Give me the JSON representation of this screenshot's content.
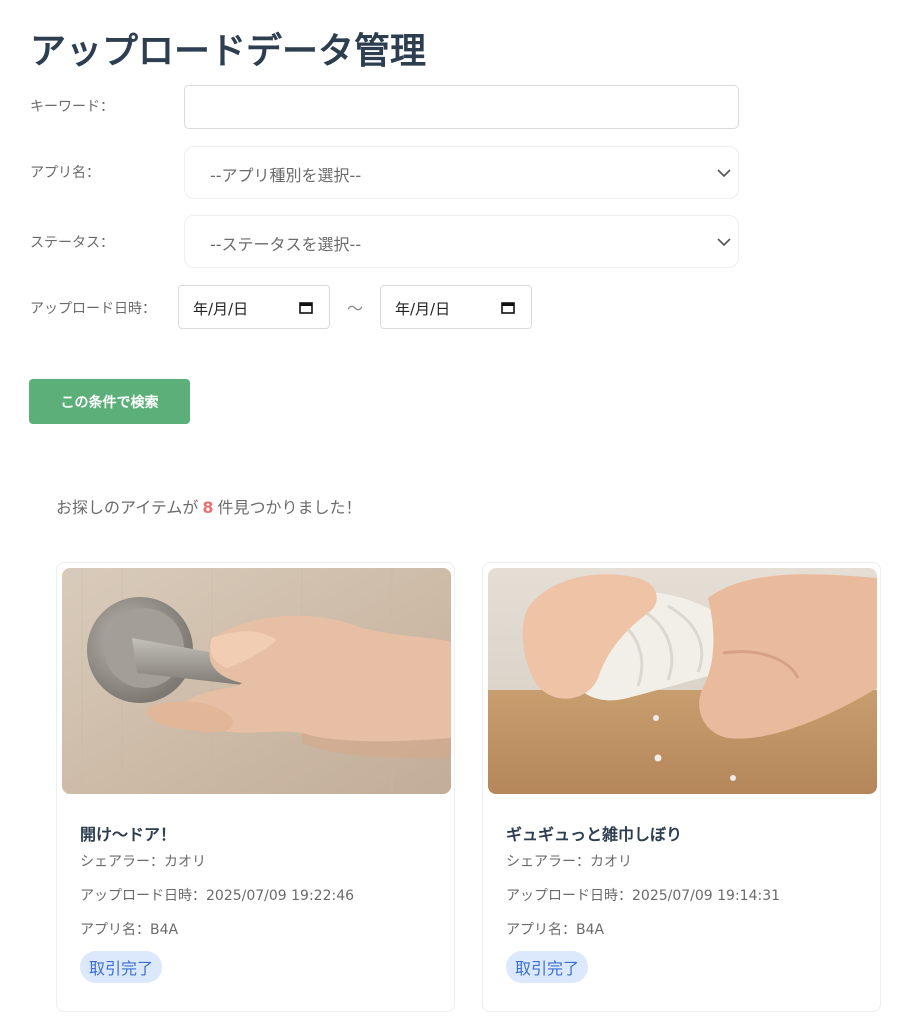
{
  "page": {
    "title": "アップロードデータ管理"
  },
  "filters": {
    "keyword_label": "キーワード：",
    "keyword_value": "",
    "app_label": "アプリ名：",
    "app_selected": "--アプリ種別を選択--",
    "status_label": "ステータス：",
    "status_selected": "--ステータスを選択--",
    "date_label": "アップロード日時：",
    "date_from": "年/月/日",
    "date_sep": "〜",
    "date_to": "年/月/日",
    "search_button": "この条件で検索"
  },
  "results": {
    "prefix": "お探しのアイテムが",
    "count": "8",
    "suffix": "件見つかりました！",
    "items": [
      {
        "title": "開け〜ドア！",
        "sharer": "シェアラー：カオリ",
        "uploaded": "アップロード日時：2025/07/09 19:22:46",
        "app": "アプリ名：B4A",
        "status": "取引完了"
      },
      {
        "title": "ギュギュっと雑巾しぼり",
        "sharer": "シェアラー：カオリ",
        "uploaded": "アップロード日時：2025/07/09 19:14:31",
        "app": "アプリ名：B4A",
        "status": "取引完了"
      }
    ]
  },
  "colors": {
    "primary_button": "#5daf79",
    "count_accent": "#e57373",
    "badge_bg": "#dce8fb",
    "badge_text": "#3a6fd0",
    "title_text": "#2c3e50"
  },
  "icons": {
    "select_arrow": "chevron-down-icon",
    "date_picker": "calendar-icon"
  }
}
